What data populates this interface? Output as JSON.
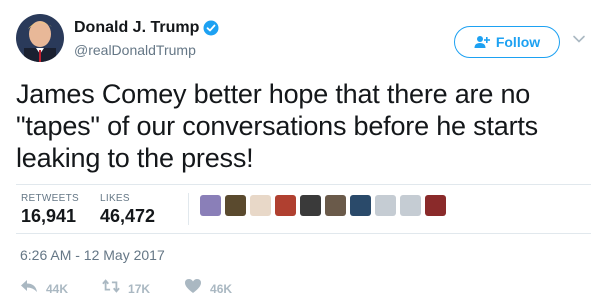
{
  "user": {
    "full_name": "Donald J. Trump",
    "handle": "@realDonaldTrump",
    "verified": true
  },
  "follow_button": {
    "label": "Follow",
    "color": "#1da1f2"
  },
  "tweet": {
    "lines": [
      "James Comey better hope that there are no",
      "\"tapes\" of our conversations before he starts",
      "leaking to the press!"
    ]
  },
  "stats": {
    "retweets_label": "RETWEETS",
    "retweets_value": "16,941",
    "likes_label": "LIKES",
    "likes_value": "46,472"
  },
  "likers": [
    {
      "name": "liker-1",
      "color": "#8a7fb8"
    },
    {
      "name": "liker-2",
      "color": "#5a4a2e"
    },
    {
      "name": "liker-3",
      "color": "#e8d8c8"
    },
    {
      "name": "liker-4",
      "color": "#b04030"
    },
    {
      "name": "liker-5",
      "color": "#3a3a3a"
    },
    {
      "name": "liker-6",
      "color": "#6a5a4a"
    },
    {
      "name": "liker-7",
      "color": "#2a4a6a"
    },
    {
      "name": "liker-8",
      "color": "#c5ccd3"
    },
    {
      "name": "liker-9",
      "color": "#c5ccd3"
    },
    {
      "name": "liker-10",
      "color": "#8a2a2a"
    }
  ],
  "timestamp": "6:26 AM - 12 May 2017",
  "actions": {
    "reply_count": "44K",
    "retweet_count": "17K",
    "like_count": "46K"
  }
}
